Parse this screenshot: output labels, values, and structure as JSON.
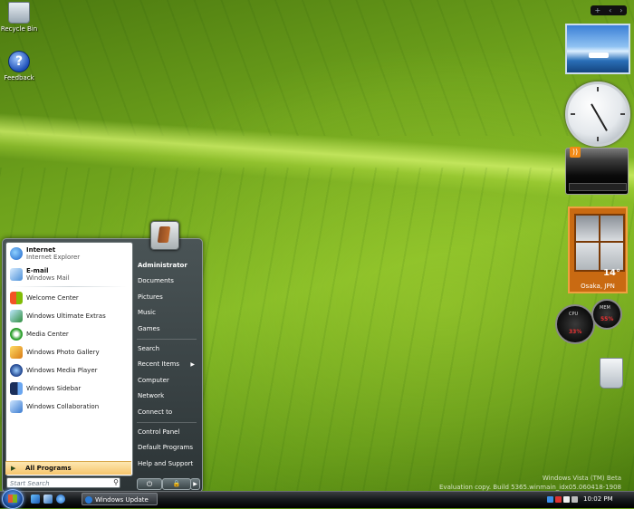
{
  "desktop": {
    "icons": [
      {
        "label": "Recycle Bin"
      },
      {
        "label": "Feedback"
      }
    ],
    "watermark": [
      "Windows Vista (TM) Beta",
      "Evaluation copy. Build 5365.winmain_idx05.060418-1908"
    ]
  },
  "sidebar": {
    "controls": [
      "+",
      "‹",
      "›"
    ],
    "weather": {
      "temperature": "14°",
      "location": "Osaka, JPN"
    },
    "cpu_meter": {
      "cpu_label": "CPU",
      "mem_label": "MEM",
      "cpu_value": "33%",
      "mem_value": "55%"
    }
  },
  "start_menu": {
    "pinned": [
      {
        "title": "Internet",
        "subtitle": "Internet Explorer"
      },
      {
        "title": "E-mail",
        "subtitle": "Windows Mail"
      }
    ],
    "recent": [
      {
        "label": "Welcome Center"
      },
      {
        "label": "Windows Ultimate Extras"
      },
      {
        "label": "Media Center"
      },
      {
        "label": "Windows Photo Gallery"
      },
      {
        "label": "Windows Media Player"
      },
      {
        "label": "Windows Sidebar"
      },
      {
        "label": "Windows Collaboration"
      }
    ],
    "all_programs": "All Programs",
    "search_placeholder": "Start Search",
    "right": {
      "user": "Administrator",
      "group1": [
        "Documents",
        "Pictures",
        "Music",
        "Games"
      ],
      "group2": [
        "Search",
        "Recent Items",
        "Computer",
        "Network",
        "Connect to"
      ],
      "group3": [
        "Control Panel",
        "Default Programs",
        "Help and Support"
      ]
    }
  },
  "taskbar": {
    "buttons": [
      {
        "label": "Windows Update"
      }
    ],
    "clock": "10:02 PM"
  },
  "colors": {
    "accent": "#4a5456",
    "all_programs_bg": "#f6c56c",
    "wallpaper": "#7fb624"
  }
}
